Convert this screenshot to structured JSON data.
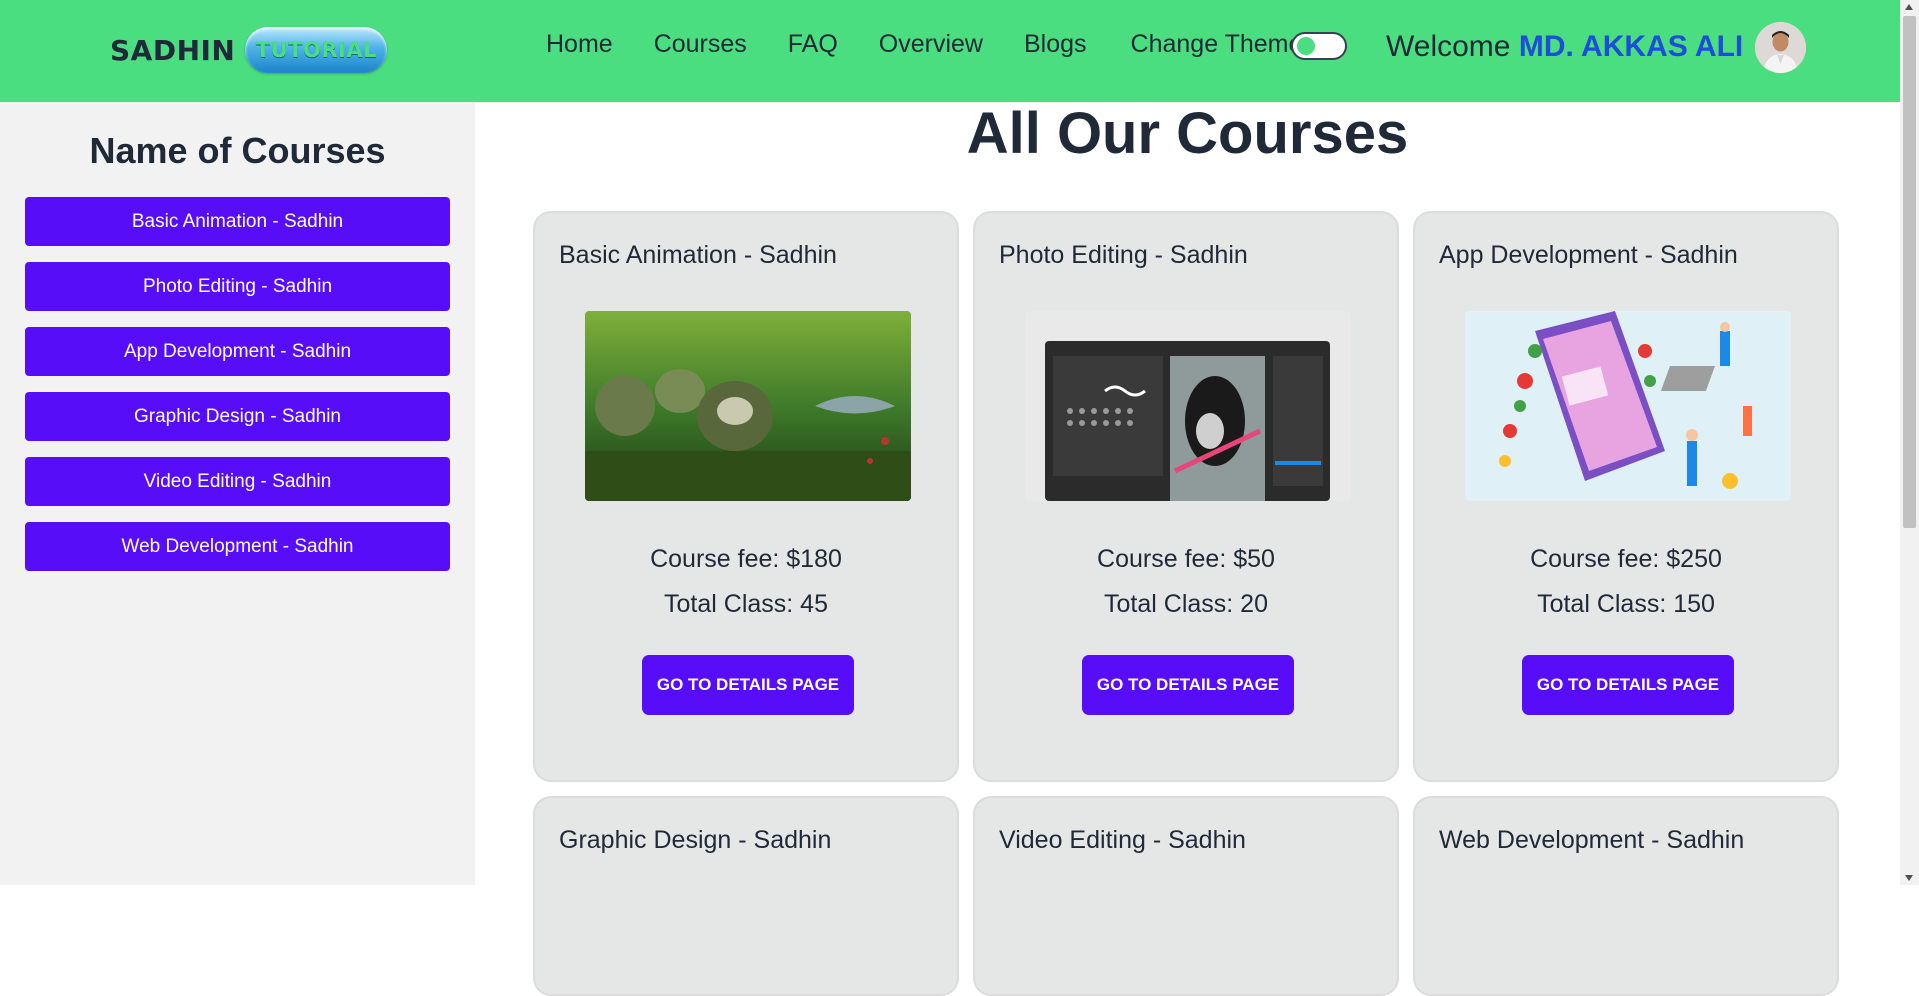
{
  "brand": {
    "name": "SADHIN",
    "badge": "TUTORIAL"
  },
  "nav": {
    "links": [
      "Home",
      "Courses",
      "FAQ",
      "Overview",
      "Blogs"
    ],
    "theme_label": "Change Theme",
    "theme_toggle_on": false
  },
  "user": {
    "welcome": "Welcome",
    "name": "MD. AKKAS ALI"
  },
  "sidebar": {
    "title": "Name of Courses",
    "items": [
      "Basic Animation - Sadhin",
      "Photo Editing - Sadhin",
      "App Development - Sadhin",
      "Graphic Design - Sadhin",
      "Video Editing - Sadhin",
      "Web Development - Sadhin"
    ]
  },
  "main": {
    "title": "All Our Courses",
    "button_label": "GO TO DETAILS PAGE",
    "courses": [
      {
        "title": "Basic Animation - Sadhin",
        "fee": "Course fee: $180",
        "classes": "Total Class: 45",
        "image": "animation-thumbnail"
      },
      {
        "title": "Photo Editing - Sadhin",
        "fee": "Course fee: $50",
        "classes": "Total Class: 20",
        "image": "photo-editing-thumbnail"
      },
      {
        "title": "App Development - Sadhin",
        "fee": "Course fee: $250",
        "classes": "Total Class: 150",
        "image": "app-development-thumbnail"
      },
      {
        "title": "Graphic Design - Sadhin"
      },
      {
        "title": "Video Editing - Sadhin"
      },
      {
        "title": "Web Development - Sadhin"
      }
    ]
  },
  "colors": {
    "navbar": "#4ade80",
    "primary_button": "#570df8",
    "username": "#1d4ed8",
    "card_bg": "#e5e6e6",
    "sidebar_bg": "#f2f2f2"
  }
}
